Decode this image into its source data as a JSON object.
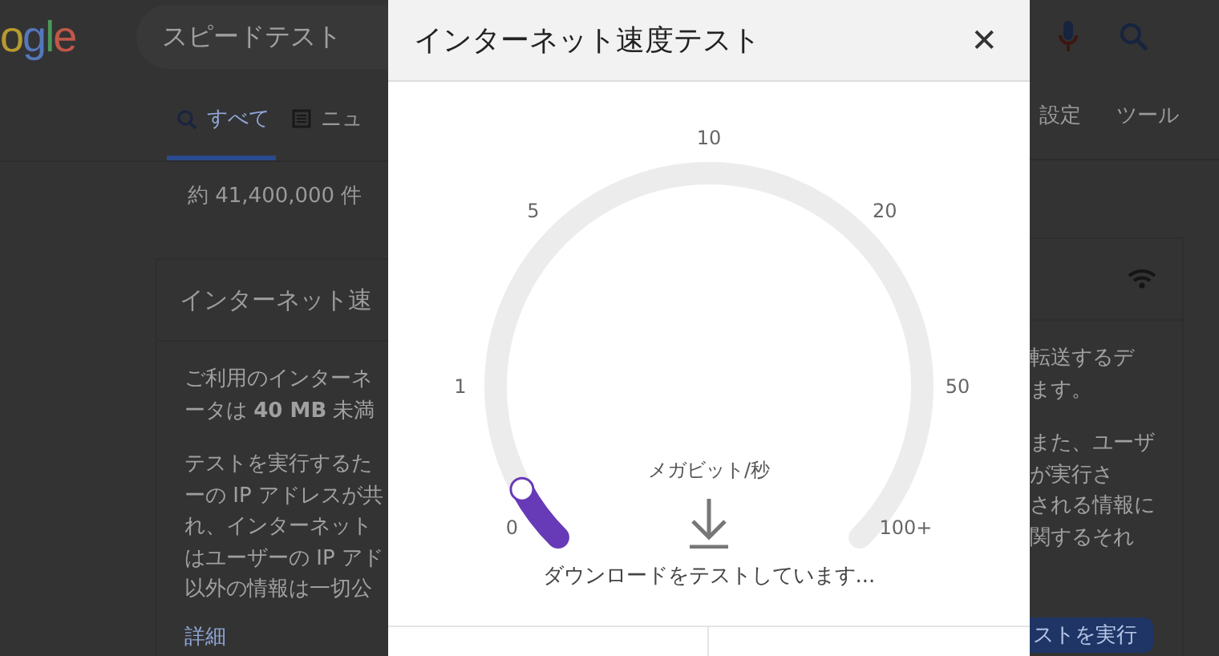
{
  "background_page": {
    "logo": "ogle",
    "search_query": "スピードテスト",
    "tabs": [
      {
        "label": "すべて",
        "selected": true
      },
      {
        "label": "ニュ",
        "selected": false
      }
    ],
    "settings": "設定",
    "tools": "ツール",
    "result_count": "約 41,400,000 件",
    "card": {
      "title": "インターネット速",
      "left_paragraphs": [
        [
          "ご利用のインターネ",
          "ータは **40 MB** 未満"
        ],
        [
          "テストを実行するた",
          "ーの IP アドレスが共",
          "れ、インターネット",
          "はユーザーの IP アド",
          "以外の情報は一切公"
        ]
      ],
      "right_paragraphs": [
        [
          "転送するデ",
          "ます。"
        ],
        [
          "また、ユーザ",
          "が実行さ",
          "される情報に",
          "関するそれ"
        ]
      ],
      "more_link": "詳細",
      "run_button": "ストを実行"
    }
  },
  "dialog": {
    "title": "インターネット速度テスト",
    "close": "✕",
    "gauge": {
      "scale": [
        "0",
        "1",
        "5",
        "10",
        "20",
        "50",
        "100+"
      ],
      "level": 0.06,
      "unit": "メガビット/秒"
    },
    "status": "ダウンロードをテストしています..."
  }
}
